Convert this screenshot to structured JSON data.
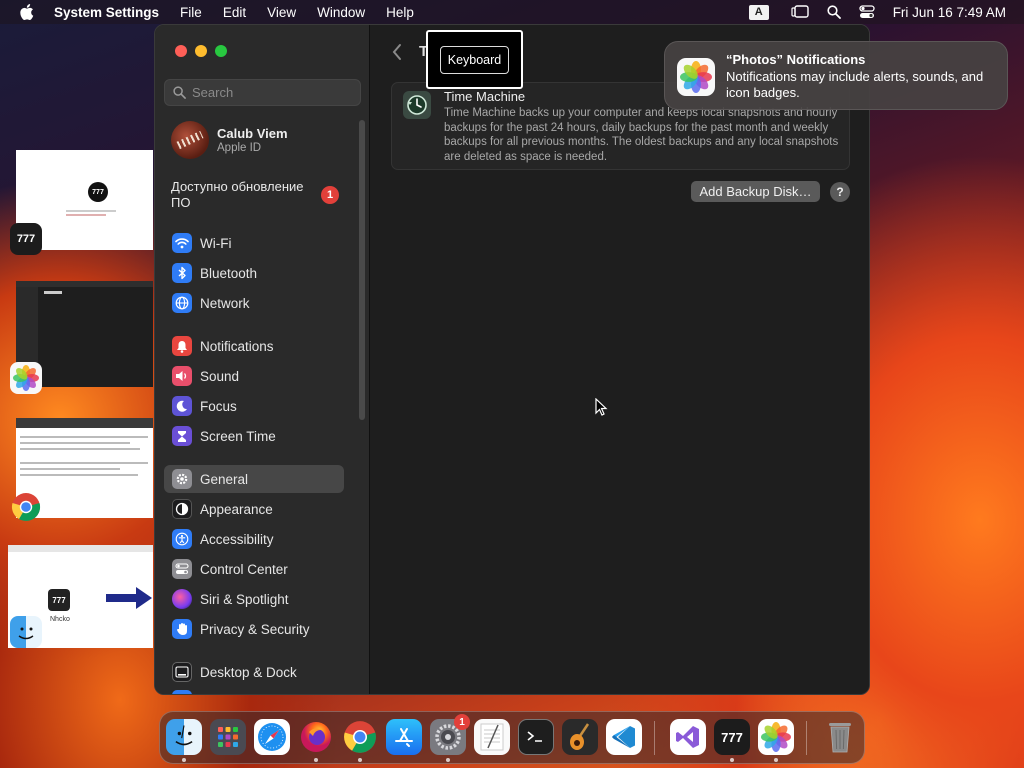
{
  "menubar": {
    "app_name": "System Settings",
    "menus": [
      "File",
      "Edit",
      "View",
      "Window",
      "Help"
    ],
    "input_source": "A",
    "clock": "Fri Jun 16  7:49 AM"
  },
  "sidebar": {
    "search_placeholder": "Search",
    "account": {
      "name": "Calub Viem",
      "subtitle": "Apple ID"
    },
    "update": {
      "label": "Доступно обновление ПО",
      "badge": "1"
    },
    "items": [
      {
        "label": "Wi-Fi",
        "icon": "wifi-icon",
        "color": "#2f7cf6"
      },
      {
        "label": "Bluetooth",
        "icon": "bluetooth-icon",
        "color": "#2f7cf6"
      },
      {
        "label": "Network",
        "icon": "globe-icon",
        "color": "#2f7cf6"
      },
      {
        "label": "Notifications",
        "icon": "bell-icon",
        "color": "#e9463f"
      },
      {
        "label": "Sound",
        "icon": "speaker-icon",
        "color": "#e94f6b"
      },
      {
        "label": "Focus",
        "icon": "moon-icon",
        "color": "#5e54d6"
      },
      {
        "label": "Screen Time",
        "icon": "hourglass-icon",
        "color": "#6a4fd6"
      },
      {
        "label": "General",
        "icon": "gear-icon",
        "color": "#8e8e93"
      },
      {
        "label": "Appearance",
        "icon": "appearance-icon",
        "color": "#1c1c1e"
      },
      {
        "label": "Accessibility",
        "icon": "accessibility-icon",
        "color": "#2f7cf6"
      },
      {
        "label": "Control Center",
        "icon": "control-center-icon",
        "color": "#8e8e93"
      },
      {
        "label": "Siri & Spotlight",
        "icon": "siri-icon",
        "color": "#9b4ad8"
      },
      {
        "label": "Privacy & Security",
        "icon": "hand-icon",
        "color": "#2f7cf6"
      },
      {
        "label": "Desktop & Dock",
        "icon": "dock-icon",
        "color": "#1c1c1e"
      }
    ],
    "selected": "General"
  },
  "content": {
    "title_partial": "T",
    "time_machine": {
      "title": "Time Machine",
      "description": "Time Machine backs up your computer and keeps local snapshots and hourly backups for the past 24 hours, daily backups for the past month and weekly backups for all previous months. The oldest backups and any local snapshots are deleted as space is needed."
    },
    "add_backup_label": "Add Backup Disk…",
    "help_label": "?"
  },
  "tooltip": {
    "label": "Keyboard"
  },
  "notification": {
    "title": "“Photos” Notifications",
    "body": "Notifications may include alerts, sounds, and icon badges."
  },
  "thumbnails": {
    "t1_app": "777",
    "t4_label": "Nhcko"
  },
  "dock": {
    "items": [
      "Finder",
      "Launchpad",
      "Safari",
      "Firefox",
      "Chrome",
      "App Store",
      "System Settings",
      "TextEdit",
      "Terminal",
      "GarageBand",
      "VS Code",
      "Visual Studio",
      "777",
      "Photos",
      "Trash"
    ],
    "settings_badge": "1"
  }
}
